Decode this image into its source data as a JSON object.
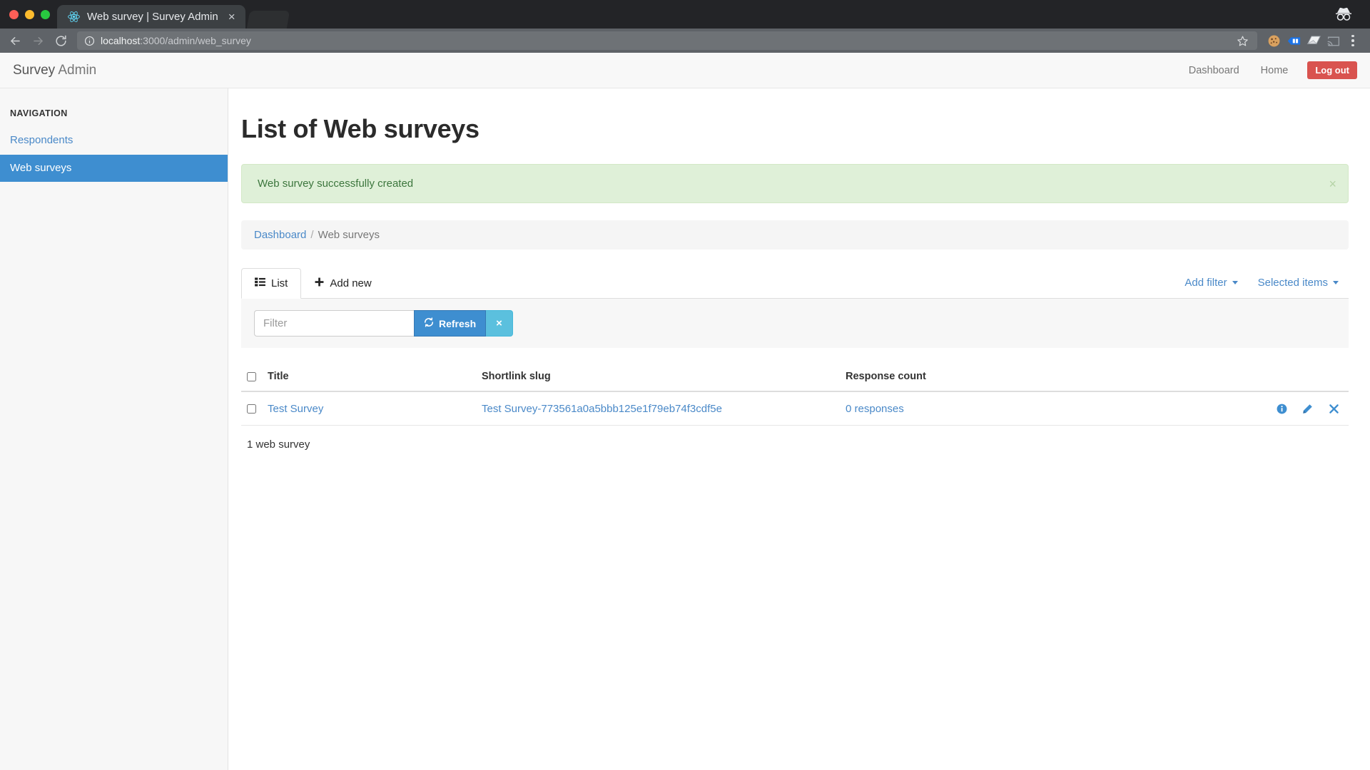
{
  "browser": {
    "tab_title": "Web survey | Survey Admin",
    "tab_favicon_name": "react-logo-favicon",
    "close_tab_label": "×",
    "url_host": "localhost",
    "url_path": ":3000/admin/web_survey",
    "back_label": "←",
    "forward_label": "→",
    "reload_label": "⟳",
    "icons": {
      "info": "site-information-icon",
      "star": "bookmark-star-icon",
      "cookie": "cookie-extension-icon",
      "bluebox": "blue-extension-icon",
      "envelope": "mail-extension-icon",
      "cast": "cast-icon",
      "menu": "chrome-menu-icon",
      "incognito": "incognito-icon"
    }
  },
  "navbar": {
    "brand_strong": "Survey",
    "brand_light": "Admin",
    "links": [
      {
        "label": "Dashboard"
      },
      {
        "label": "Home"
      }
    ],
    "logout_label": "Log out",
    "logout_color": "#d9534f"
  },
  "sidebar": {
    "header": "NAVIGATION",
    "items": [
      {
        "label": "Respondents",
        "active": false
      },
      {
        "label": "Web surveys",
        "active": true
      }
    ],
    "active_color": "#3e8ed0"
  },
  "main": {
    "page_title": "List of Web surveys",
    "alert": {
      "message": "Web survey successfully created",
      "close_label": "×",
      "background": "#dff0d8",
      "text_color": "#3c763d"
    },
    "breadcrumb": {
      "link": "Dashboard",
      "separator": "/",
      "current": "Web surveys"
    },
    "tabs": [
      {
        "label": "List",
        "icon": "list-icon",
        "active": true
      },
      {
        "label": "Add new",
        "icon": "plus-icon",
        "active": false
      }
    ],
    "tab_dropdowns": [
      {
        "label": "Add filter"
      },
      {
        "label": "Selected items"
      }
    ],
    "filter": {
      "value": "",
      "placeholder": "Filter",
      "refresh_label": "Refresh",
      "refresh_icon": "refresh-icon",
      "clear_label": "×",
      "refresh_color": "#3e8ed0",
      "clear_color": "#5bc0de"
    },
    "table": {
      "columns": [
        "Title",
        "Shortlink slug",
        "Response count"
      ],
      "rows": [
        {
          "title": "Test Survey",
          "slug": "Test Survey-773561a0a5bbb125e1f79eb74f3cdf5e",
          "response_count": "0 responses",
          "actions": [
            {
              "name": "info-icon",
              "label": "Details"
            },
            {
              "name": "pencil-icon",
              "label": "Edit"
            },
            {
              "name": "close-icon",
              "label": "Delete"
            }
          ]
        }
      ],
      "footer": "1 web survey"
    }
  }
}
